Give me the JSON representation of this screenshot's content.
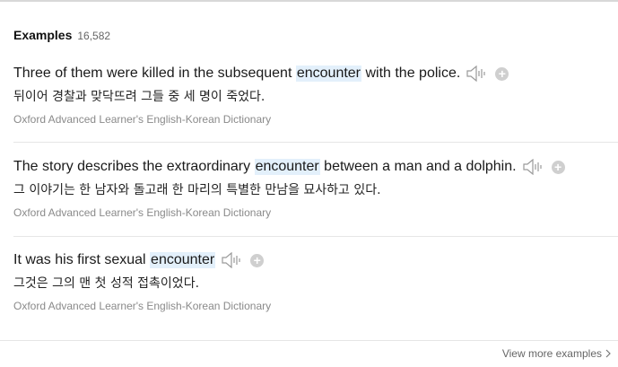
{
  "header": {
    "title": "Examples",
    "count": "16,582"
  },
  "examples": [
    {
      "before": "Three of them were killed in the subsequent ",
      "keyword": "encounter",
      "after": " with the police.",
      "translation": "뒤이어 경찰과 맞닥뜨려 그들 중 세 명이 죽었다.",
      "source": "Oxford Advanced Learner's English-Korean Dictionary"
    },
    {
      "before": "The story describes the extraordinary ",
      "keyword": "encounter",
      "after": " between a man and a dolphin.",
      "translation": "그 이야기는 한 남자와 돌고래 한 마리의 특별한 만남을 묘사하고 있다.",
      "source": "Oxford Advanced Learner's English-Korean Dictionary"
    },
    {
      "before": "It was his first sexual ",
      "keyword": "encounter",
      "after": "",
      "translation": "그것은 그의 맨 첫 성적 접촉이었다.",
      "source": "Oxford Advanced Learner's English-Korean Dictionary"
    }
  ],
  "footer": {
    "more_label": "View more examples"
  },
  "icons": {
    "audio": "speaker-icon",
    "add": "plus-icon",
    "more": "chevron-right-icon"
  },
  "colors": {
    "highlight": "#e3f0fb",
    "source_text": "#8a8a8a"
  }
}
